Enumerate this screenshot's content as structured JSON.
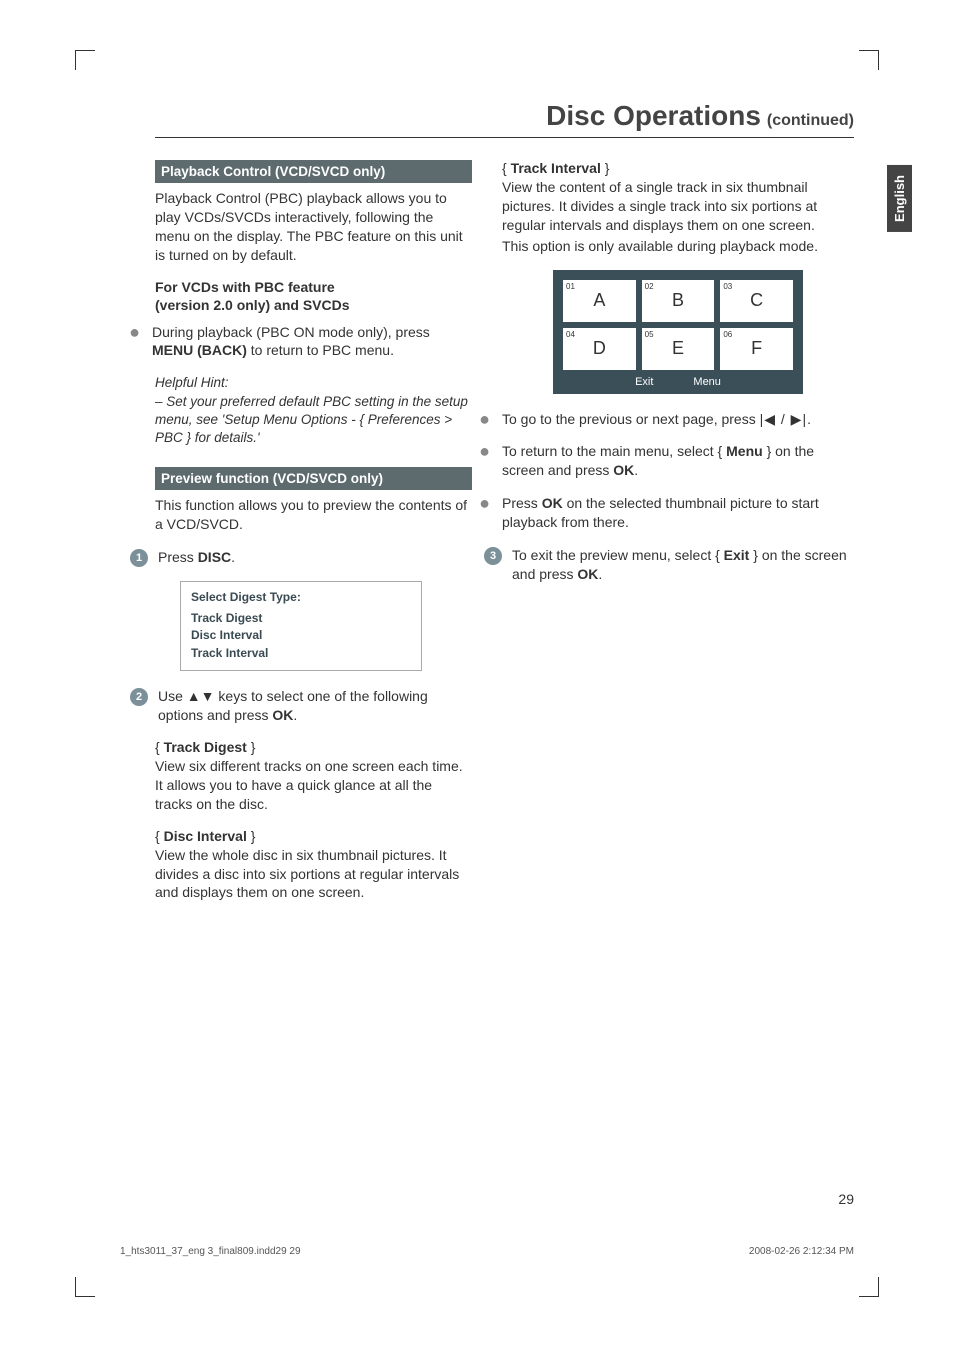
{
  "header": {
    "title": "Disc Operations",
    "continued": "(continued)"
  },
  "langTab": "English",
  "left": {
    "pbcBar": "Playback Control (VCD/SVCD only)",
    "pbcIntro": "Playback Control (PBC) playback allows you to play VCDs/SVCDs interactively, following the menu on the display. The PBC feature on this unit is turned on by default.",
    "pbcSub1": "For VCDs with PBC feature",
    "pbcSub2": "(version 2.0 only) and SVCDs",
    "pbcBullet_pre": "During playback (PBC ON mode only), press ",
    "pbcBullet_bold": "MENU (BACK)",
    "pbcBullet_post": " to return to PBC menu.",
    "hintTitle": "Helpful Hint:",
    "hintBody": "– Set your preferred default PBC setting in the setup menu, see 'Setup Menu Options - { Preferences > PBC } for details.'",
    "previewBar": "Preview function (VCD/SVCD only)",
    "previewIntro": "This function allows you to preview the contents of a VCD/SVCD.",
    "step1_pre": "Press ",
    "step1_bold": "DISC",
    "step1_post": ".",
    "digestBox": {
      "title": "Select Digest Type:",
      "items": [
        "Track Digest",
        "Disc Interval",
        "Track Interval"
      ]
    },
    "step2_pre": "Use ",
    "step2_arrows": "▲▼",
    "step2_mid": " keys to select one of the following options and press ",
    "step2_bold": "OK",
    "step2_post": ".",
    "trackDigestLabel": "Track Digest",
    "trackDigestBody": "View six different tracks on one screen each time. It allows you to have a quick glance at all the tracks on the disc.",
    "discIntervalLabel": "Disc Interval",
    "discIntervalBody": "View the whole disc in six thumbnail pictures. It divides a disc into six portions at regular intervals and displays them on one screen."
  },
  "right": {
    "trackIntervalLabel": "Track Interval",
    "trackIntervalBody": "View the content of a single track in six thumbnail pictures. It divides a single track into six portions at regular intervals and displays them on one screen.",
    "trackIntervalBody2": "This option is only available during playback mode.",
    "thumbs": [
      {
        "n": "01",
        "l": "A"
      },
      {
        "n": "02",
        "l": "B"
      },
      {
        "n": "03",
        "l": "C"
      },
      {
        "n": "04",
        "l": "D"
      },
      {
        "n": "05",
        "l": "E"
      },
      {
        "n": "06",
        "l": "F"
      }
    ],
    "gridBtns": [
      "Exit",
      "Menu"
    ],
    "b1_pre": "To go to the previous or next page, press ",
    "b1_icons": "|◀ / ▶|",
    "b1_post": ".",
    "b2_pre": "To return to the main menu, select { ",
    "b2_bold": "Menu",
    "b2_mid": " } on the screen and press ",
    "b2_bold2": "OK",
    "b2_post": ".",
    "b3_pre": "Press ",
    "b3_bold": "OK",
    "b3_post": " on the selected thumbnail picture to start playback from there.",
    "step3_pre": "To exit the preview menu, select { ",
    "step3_bold": "Exit",
    "step3_mid": " } on the screen and press ",
    "step3_bold2": "OK",
    "step3_post": "."
  },
  "pageNum": "29",
  "footer": {
    "left": "1_hts3011_37_eng 3_final809.indd29   29",
    "right": "2008-02-26   2:12:34 PM"
  }
}
